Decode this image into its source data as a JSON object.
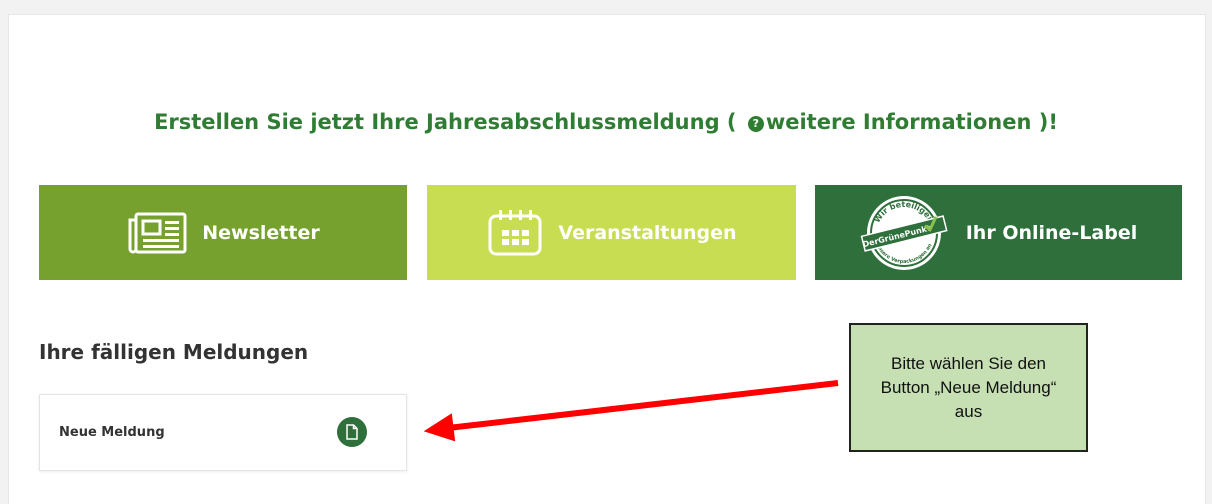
{
  "headline": {
    "before": "Erstellen Sie jetzt Ihre Jahresabschlussmeldung ( ",
    "info_glyph": "?",
    "link": "weitere Informationen",
    "after": " )!"
  },
  "tiles": [
    {
      "label": "Newsletter",
      "icon": "newspaper-icon",
      "color": "#76a12f"
    },
    {
      "label": "Veranstaltungen",
      "icon": "calendar-icon",
      "color": "#c8dd52"
    },
    {
      "label": "Ihr Online-Label",
      "icon": "gruener-punkt-seal-icon",
      "color": "#2e6f3b",
      "seal": {
        "top": "Wir beteiligen",
        "middle": "DerGrünePunkt",
        "bottom": "unsere Verpackungen an"
      }
    }
  ],
  "section": {
    "title": "Ihre fälligen Meldungen"
  },
  "report_card": {
    "label": "Neue Meldung",
    "button_icon": "document-icon"
  },
  "callout": {
    "text": "Bitte wählen Sie den Button „Neue Meldung“ aus",
    "background": "#c6e0b4"
  },
  "colors": {
    "brand_green": "#2e7d32",
    "arrow_red": "#ff0000"
  }
}
